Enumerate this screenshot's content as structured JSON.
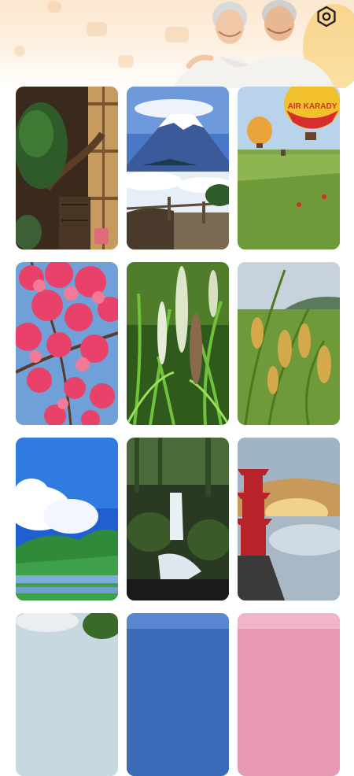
{
  "header": {
    "settings_icon": "settings-icon",
    "banner": "elderly-couple-banner"
  },
  "wallpapers": [
    {
      "subject": "japanese-garden-pine"
    },
    {
      "subject": "mount-fuji-cloud-sea"
    },
    {
      "subject": "hot-air-balloons-field"
    },
    {
      "subject": "cherry-blossoms"
    },
    {
      "subject": "grass-flower-spikes"
    },
    {
      "subject": "rice-ears-field"
    },
    {
      "subject": "blue-sky-rice-terraces"
    },
    {
      "subject": "forest-waterfall"
    },
    {
      "subject": "pagoda-sea-of-clouds"
    },
    {
      "subject": "cloudy-sky"
    },
    {
      "subject": "blue-sky"
    },
    {
      "subject": "pink-sky"
    }
  ],
  "balloon_text": "AIR KARADY",
  "colors": {
    "header_bg": "#fbe7cf",
    "page_bg": "#ffffff",
    "icon": "#222222"
  }
}
